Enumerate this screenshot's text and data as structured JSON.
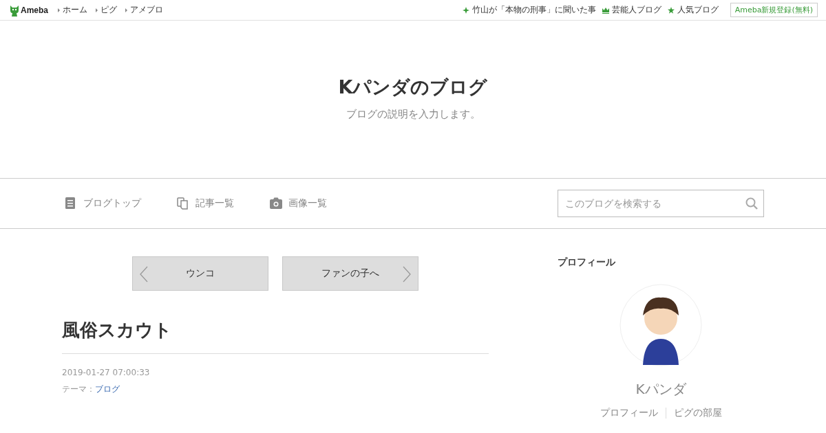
{
  "top_bar": {
    "logo": "Ameba",
    "links": [
      "ホーム",
      "ピグ",
      "アメブロ"
    ],
    "right_links": [
      {
        "kind": "sparkle",
        "label": "竹山が「本物の刑事」に聞いた事"
      },
      {
        "kind": "crown",
        "label": "芸能人ブログ"
      },
      {
        "kind": "star",
        "label": "人気ブログ"
      }
    ],
    "register_button": "Ameba新規登録(無料)"
  },
  "header": {
    "title": "Kパンダのブログ",
    "description": "ブログの説明を入力します。"
  },
  "nav": {
    "items": [
      {
        "kind": "document",
        "label": "ブログトップ"
      },
      {
        "kind": "copy",
        "label": "記事一覧"
      },
      {
        "kind": "camera",
        "label": "画像一覧"
      }
    ],
    "search": {
      "placeholder": "このブログを検索する"
    }
  },
  "article": {
    "prev": "ウンコ",
    "next": "ファンの子へ",
    "title": "風俗スカウト",
    "date": "2019-01-27 07:00:33",
    "theme_label": "テーマ：",
    "theme": "ブログ"
  },
  "sidebar": {
    "heading": "プロフィール",
    "name": "Kパンダ",
    "links": [
      "プロフィール",
      "ピグの部屋"
    ]
  }
}
